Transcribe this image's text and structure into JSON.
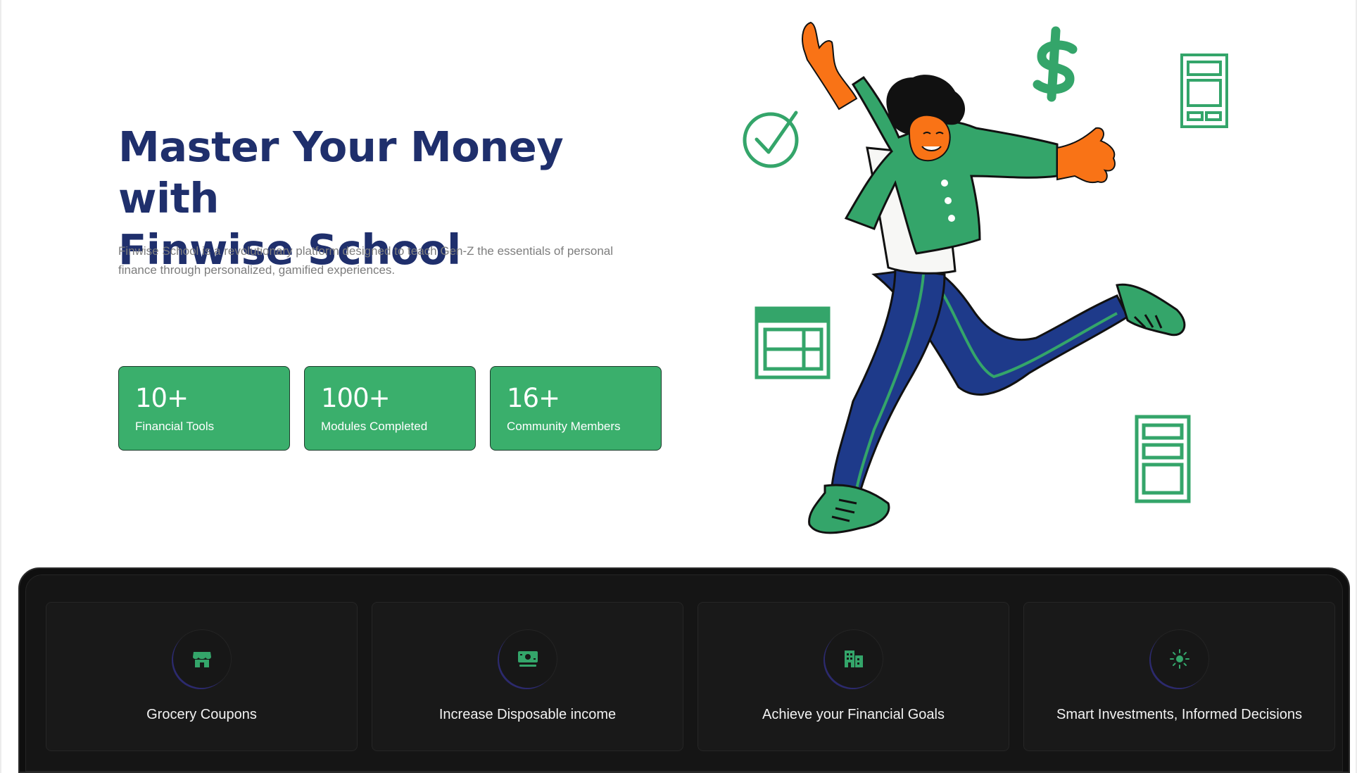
{
  "hero": {
    "title_line1": "Master Your Money with",
    "title_line2": "Finwise School",
    "description": "Finwise School is a revolutionary platform designed to teach Gen-Z the essentials of personal finance through personalized, gamified experiences."
  },
  "stats": [
    {
      "value": "10+",
      "label": "Financial Tools"
    },
    {
      "value": "100+",
      "label": "Modules Completed"
    },
    {
      "value": "16+",
      "label": "Community Members"
    }
  ],
  "features": [
    {
      "label": "Grocery Coupons",
      "icon": "store-icon"
    },
    {
      "label": "Increase Disposable income",
      "icon": "cash-icon"
    },
    {
      "label": "Achieve your Financial Goals",
      "icon": "building-icon"
    },
    {
      "label": "Smart Investments, Informed Decisions",
      "icon": "sun-icon"
    }
  ],
  "colors": {
    "title": "#1f2f6c",
    "accent_green": "#3aaf6c",
    "dark_panel": "#0f0f0f",
    "illustration_orange": "#f97316",
    "illustration_navy": "#1e3a8a"
  }
}
